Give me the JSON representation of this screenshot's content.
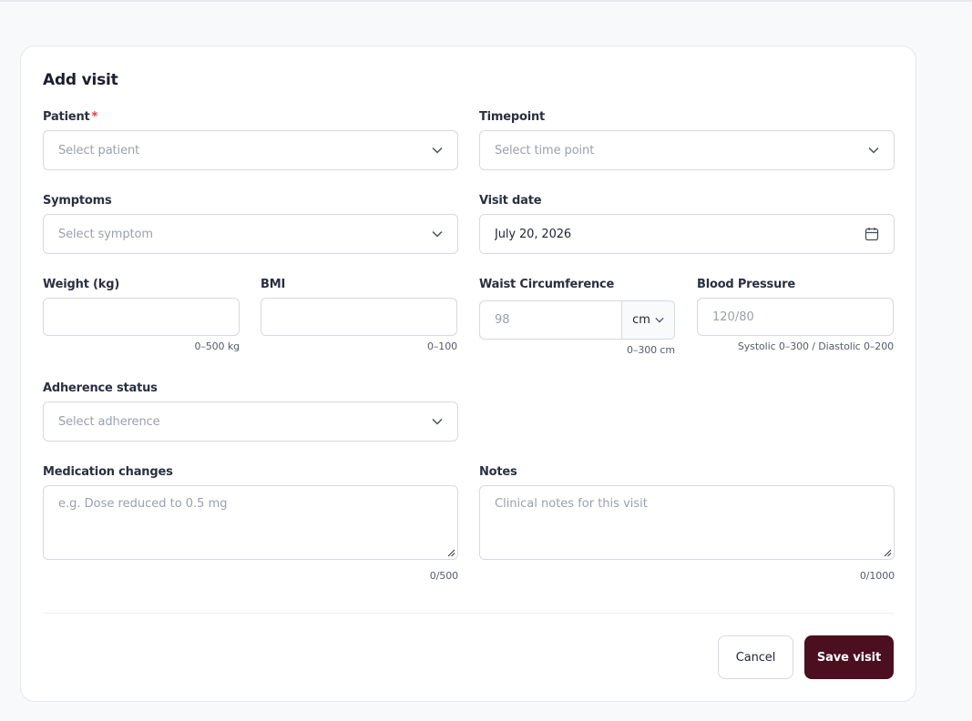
{
  "form": {
    "title": "Add visit",
    "patient": {
      "label": "Patient",
      "required_mark": "*",
      "placeholder": "Select patient"
    },
    "timepoint": {
      "label": "Timepoint",
      "placeholder": "Select time point"
    },
    "symptoms": {
      "label": "Symptoms",
      "placeholder": "Select symptom"
    },
    "visit_date": {
      "label": "Visit date",
      "value": "July 20, 2026"
    },
    "weight": {
      "label": "Weight (kg)",
      "hint": "0–500 kg"
    },
    "bmi": {
      "label": "BMI",
      "hint": "0–100"
    },
    "waist": {
      "label": "Waist Circumference",
      "placeholder": "98",
      "unit": "cm",
      "hint": "0–300 cm"
    },
    "blood_pressure": {
      "label": "Blood Pressure",
      "placeholder": "120/80",
      "hint": "Systolic 0–300 / Diastolic 0–200"
    },
    "adherence": {
      "label": "Adherence status",
      "placeholder": "Select adherence"
    },
    "medication": {
      "label": "Medication changes",
      "placeholder": "e.g. Dose reduced to 0.5 mg",
      "counter": "0/500"
    },
    "notes": {
      "label": "Notes",
      "placeholder": "Clinical notes for this visit",
      "counter": "0/1000"
    }
  },
  "actions": {
    "cancel_label": "Cancel",
    "save_label": "Save visit"
  },
  "colors": {
    "primary": "#4b0f1f",
    "required": "#e03b3b",
    "border": "#d6d9df"
  },
  "icons": {
    "dropdown": "chevron-down-icon",
    "date": "calendar-icon",
    "resize": "resize-grip-icon"
  }
}
